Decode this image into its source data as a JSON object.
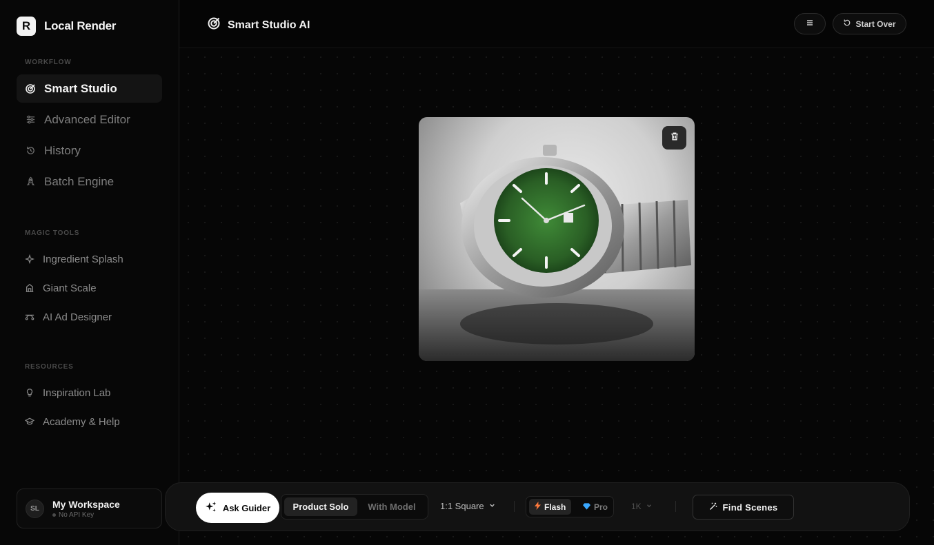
{
  "brand": {
    "logo_letter": "R",
    "name": "Local Render"
  },
  "sidebar": {
    "workflow_label": "WORKFLOW",
    "workflow_items": [
      {
        "label": "Smart Studio",
        "icon": "target-icon",
        "active": true
      },
      {
        "label": "Advanced Editor",
        "icon": "sliders-icon",
        "active": false
      },
      {
        "label": "History",
        "icon": "history-icon",
        "active": false
      },
      {
        "label": "Batch Engine",
        "icon": "rocket-icon",
        "active": false
      }
    ],
    "magic_label": "MAGIC TOOLS",
    "magic_items": [
      {
        "label": "Ingredient Splash",
        "icon": "sparkle-icon"
      },
      {
        "label": "Giant Scale",
        "icon": "building-icon"
      },
      {
        "label": "AI Ad Designer",
        "icon": "bezier-icon"
      }
    ],
    "resources_label": "RESOURCES",
    "resources_items": [
      {
        "label": "Inspiration Lab",
        "icon": "bulb-icon"
      },
      {
        "label": "Academy & Help",
        "icon": "graduation-cap-icon"
      }
    ]
  },
  "workspace": {
    "initials": "SL",
    "name": "My Workspace",
    "status": "No API Key"
  },
  "header": {
    "title": "Smart Studio AI",
    "start_over_label": "Start Over"
  },
  "toolbar": {
    "ask_label": "Ask Guider",
    "mode_options": [
      "Product Solo",
      "With Model"
    ],
    "aspect_label": "1:1 Square",
    "model_options": [
      "Flash",
      "Pro"
    ],
    "resolution_label": "1K",
    "find_scenes_label": "Find Scenes"
  },
  "colors": {
    "accent_white": "#ffffff",
    "background": "#050505",
    "watch_dial": "#2f6b2a",
    "flash_icon": "#ff7a3d",
    "pro_icon": "#3aa8ff"
  }
}
